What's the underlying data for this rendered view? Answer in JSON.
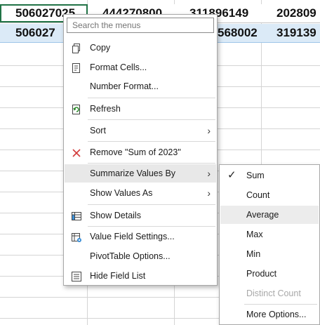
{
  "sheet": {
    "row1": [
      "506027025",
      "444270800",
      "311896149",
      "202809"
    ],
    "row2": [
      "506027",
      "",
      "568002",
      "319139"
    ]
  },
  "menu": {
    "search_placeholder": "Search the menus",
    "items": {
      "copy": "Copy",
      "format_cells": "Format Cells...",
      "number_format": "Number Format...",
      "refresh": "Refresh",
      "sort": "Sort",
      "remove": "Remove \"Sum of 2023\"",
      "summarize": "Summarize Values By",
      "show_values": "Show Values As",
      "show_details": "Show Details",
      "value_field_settings": "Value Field Settings...",
      "pivot_options": "PivotTable Options...",
      "hide_field_list": "Hide Field List"
    }
  },
  "submenu": {
    "items": {
      "sum": "Sum",
      "count": "Count",
      "average": "Average",
      "max": "Max",
      "min": "Min",
      "product": "Product",
      "distinct_count": "Distinct Count",
      "more_options": "More Options..."
    },
    "checked": "Sum"
  },
  "icons": {
    "copy": "copy-icon",
    "format_cells": "format-cells-icon",
    "refresh": "refresh-icon",
    "remove": "remove-x-icon",
    "show_details": "show-details-icon",
    "value_field_settings": "value-field-settings-icon",
    "hide_field_list": "field-list-icon",
    "check": "checkmark-icon"
  }
}
